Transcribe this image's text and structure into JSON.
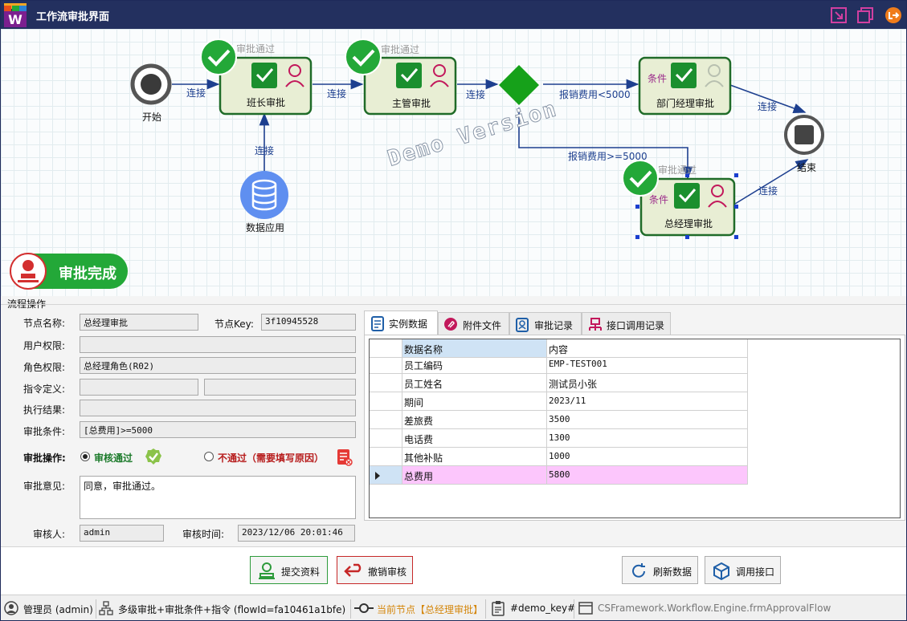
{
  "window": {
    "title": "工作流审批界面",
    "logo_letter": "W"
  },
  "flow": {
    "start_label": "开始",
    "end_label": "结束",
    "data_node_label": "数据应用",
    "nodes": {
      "banzhang": "班长审批",
      "zhuguan": "主管审批",
      "bumen": "部门经理审批",
      "zongjingli": "总经理审批"
    },
    "status_approved": "审批通过",
    "condition_tag": "条件",
    "edge_connect": "连接",
    "edge_lt": "报销费用<5000",
    "edge_ge": "报销费用>=5000",
    "watermark": "Demo Version",
    "done_badge": "审批完成"
  },
  "form": {
    "section_title": "流程操作",
    "node_name_label": "节点名称:",
    "node_name_value": "总经理审批",
    "node_key_label": "节点Key:",
    "node_key_value": "3f10945528",
    "user_perm_label": "用户权限:",
    "user_perm_value": "",
    "role_perm_label": "角色权限:",
    "role_perm_value": "总经理角色(R02)",
    "cmd_label": "指令定义:",
    "result_label": "执行结果:",
    "condition_label": "审批条件:",
    "condition_value": "[总费用]>=5000",
    "op_label": "审批操作:",
    "op_pass": "审核通过",
    "op_reject": "不通过（需要填写原因）",
    "opinion_label": "审批意见:",
    "opinion_value": "同意，审批通过。",
    "auditor_label": "审核人:",
    "auditor_value": "admin",
    "audit_time_label": "审核时间:",
    "audit_time_value": "2023/12/06 20:01:46"
  },
  "tabs": [
    "实例数据",
    "附件文件",
    "审批记录",
    "接口调用记录"
  ],
  "grid": {
    "headers": [
      "数据名称",
      "内容"
    ],
    "rows": [
      [
        "员工编码",
        "EMP-TEST001"
      ],
      [
        "员工姓名",
        "测试员小张"
      ],
      [
        "期间",
        "2023/11"
      ],
      [
        "差旅费",
        "3500"
      ],
      [
        "电话费",
        "1300"
      ],
      [
        "其他补贴",
        "1000"
      ],
      [
        "总费用",
        "5800"
      ]
    ]
  },
  "buttons": {
    "submit": "提交资料",
    "revoke": "撤销审核",
    "refresh": "刷新数据",
    "call_api": "调用接口"
  },
  "statusbar": {
    "user": "管理员 (admin)",
    "flow": "多级审批+审批条件+指令 (flowId=fa10461a1bfe)",
    "current_node": "当前节点【总经理审批】",
    "demo_key": "#demo_key#",
    "form_class": "CSFramework.Workflow.Engine.frmApprovalFlow"
  },
  "colors": {
    "titlebar": "#23305f",
    "node_fill": "#e8eed4",
    "node_border": "#1f6b28",
    "accent_green": "#23a838",
    "edge": "#1d3f8f"
  }
}
